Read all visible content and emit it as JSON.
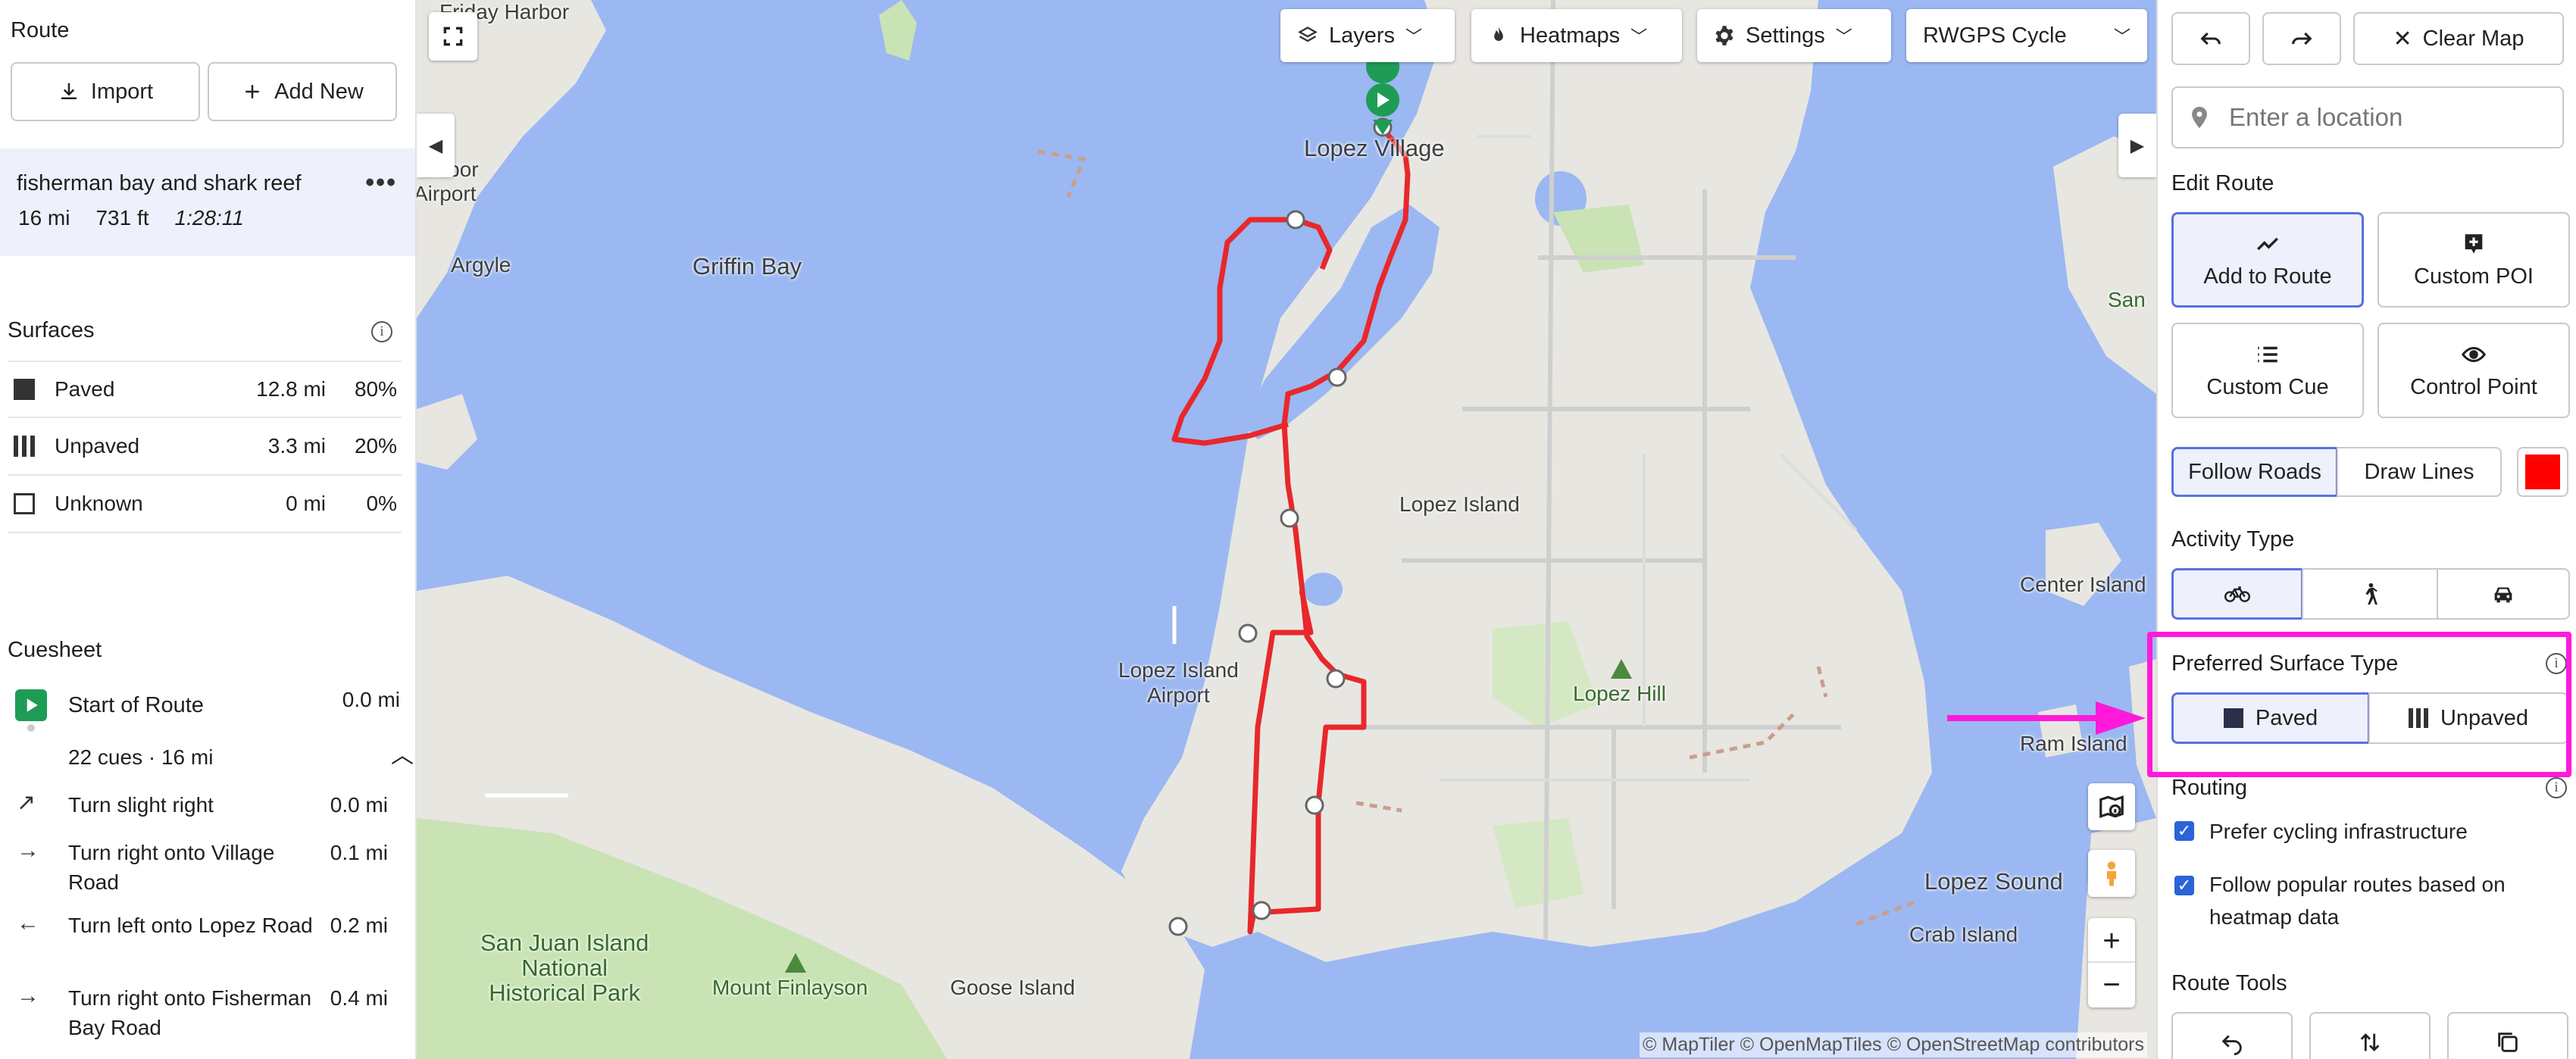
{
  "left_panel": {
    "route_heading": "Route",
    "import_label": "Import",
    "add_new_label": "Add New",
    "route": {
      "name": "fisherman bay and shark reef",
      "distance": "16 mi",
      "elevation": "731 ft",
      "duration": "1:28:11",
      "more_label": "•••"
    },
    "surfaces": {
      "heading": "Surfaces",
      "rows": [
        {
          "name": "Paved",
          "distance": "12.8 mi",
          "percent": "80%"
        },
        {
          "name": "Unpaved",
          "distance": "3.3 mi",
          "percent": "20%"
        },
        {
          "name": "Unknown",
          "distance": "0 mi",
          "percent": "0%"
        }
      ]
    },
    "cuesheet": {
      "heading": "Cuesheet",
      "start": {
        "label": "Start of Route",
        "distance": "0.0 mi"
      },
      "summary": "22 cues · 16 mi",
      "cues": [
        {
          "icon": "arrow-up-right-icon",
          "glyph": "↗",
          "text": "Turn slight right",
          "distance": "0.0 mi"
        },
        {
          "icon": "arrow-right-icon",
          "glyph": "→",
          "text": "Turn right onto Village Road",
          "distance": "0.1 mi"
        },
        {
          "icon": "arrow-left-icon",
          "glyph": "←",
          "text": "Turn left onto Lopez Road",
          "distance": "0.2 mi"
        },
        {
          "icon": "arrow-right-icon",
          "glyph": "→",
          "text": "Turn right onto Fisherman Bay Road",
          "distance": "0.4 mi"
        }
      ]
    }
  },
  "map": {
    "controls": {
      "layers": "Layers",
      "heatmaps": "Heatmaps",
      "settings": "Settings",
      "map_style": "RWGPS Cycle"
    },
    "labels": {
      "friday_harbor": "Friday Harbor",
      "harbor_airport": "Harbor\nAirport",
      "argyle": "Argyle",
      "griffin_bay": "Griffin Bay",
      "lopez_village": "Lopez Village",
      "lopez_island": "Lopez Island",
      "lopez_island_airport": "Lopez Island\nAirport",
      "lopez_hill": "Lopez Hill",
      "center_island": "Center Island",
      "ram_island": "Ram Island",
      "lopez_sound": "Lopez Sound",
      "crab_island": "Crab Island",
      "goose_island": "Goose Island",
      "mount_finlayson": "Mount Finlayson",
      "san_juan_park": "San Juan Island\nNational\nHistorical Park",
      "san_edge": "San"
    },
    "attribution": "© MapTiler © OpenMapTiles © OpenStreetMap contributors",
    "zoom_in": "+",
    "zoom_out": "−",
    "route_color": "#e8282b"
  },
  "right_panel": {
    "clear_map": "Clear Map",
    "location_placeholder": "Enter a location",
    "edit_route": {
      "heading": "Edit Route",
      "add_to_route": "Add to Route",
      "custom_poi": "Custom POI",
      "custom_cue": "Custom Cue",
      "control_point": "Control Point",
      "follow_roads": "Follow Roads",
      "draw_lines": "Draw Lines",
      "line_color": "#ff0000"
    },
    "activity_type": {
      "heading": "Activity Type"
    },
    "surface_type": {
      "heading": "Preferred Surface Type",
      "paved": "Paved",
      "unpaved": "Unpaved"
    },
    "routing": {
      "heading": "Routing",
      "prefer_cycling": "Prefer cycling infrastructure",
      "follow_popular": "Follow popular routes based on heatmap data"
    },
    "route_tools": {
      "heading": "Route Tools"
    },
    "highlight_color": "#ff1ad9"
  }
}
